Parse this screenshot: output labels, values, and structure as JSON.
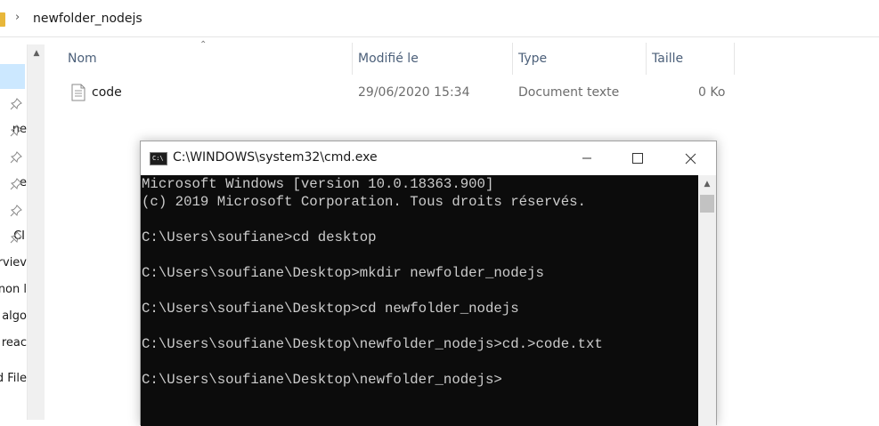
{
  "explorer": {
    "breadcrumb": "newfolder_nodejs",
    "nav_items": [
      "ne",
      "e",
      "CI",
      "rviev",
      "non l",
      "algo",
      "reac",
      "d File"
    ],
    "columns": {
      "name": "Nom",
      "modified": "Modifié le",
      "type": "Type",
      "size": "Taille"
    },
    "files": [
      {
        "name": "code",
        "modified": "29/06/2020 15:34",
        "type": "Document texte",
        "size": "0 Ko"
      }
    ]
  },
  "cmd": {
    "title": "C:\\WINDOWS\\system32\\cmd.exe",
    "icon_text": "C:\\",
    "lines": [
      "Microsoft Windows [version 10.0.18363.900]",
      "(c) 2019 Microsoft Corporation. Tous droits réservés.",
      "",
      "C:\\Users\\soufiane>cd desktop",
      "",
      "C:\\Users\\soufiane\\Desktop>mkdir newfolder_nodejs",
      "",
      "C:\\Users\\soufiane\\Desktop>cd newfolder_nodejs",
      "",
      "C:\\Users\\soufiane\\Desktop\\newfolder_nodejs>cd.>code.txt",
      "",
      "C:\\Users\\soufiane\\Desktop\\newfolder_nodejs>"
    ]
  },
  "colors": {
    "console_bg": "#0c0c0c",
    "console_text": "#cccccc",
    "header_text": "#4c607a",
    "selection": "#cce8ff"
  }
}
